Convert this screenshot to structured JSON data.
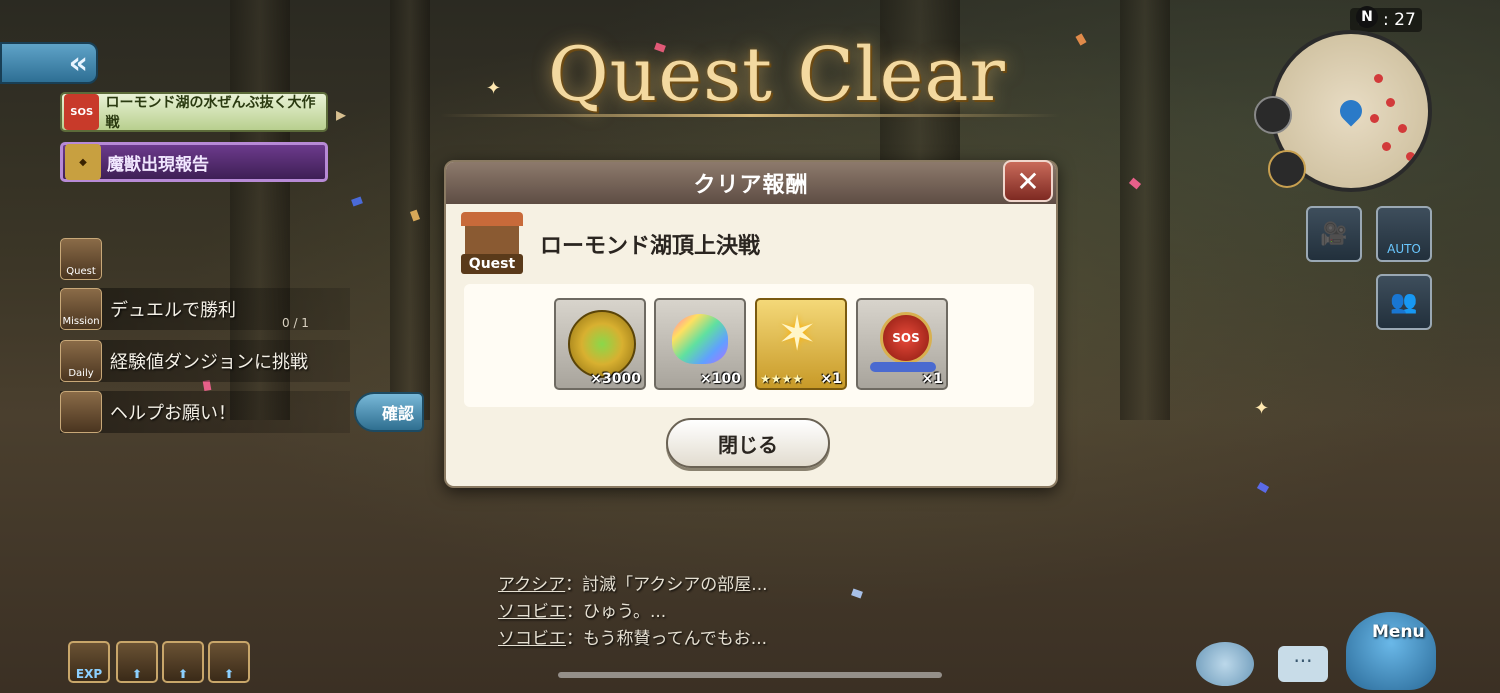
{
  "title": "Quest Clear",
  "hud": {
    "time": "07 : 27",
    "compass": "N"
  },
  "left_panel": {
    "back_label": "«",
    "event_banner": "ローモンド湖の水ぜんぶ抜く大作戦",
    "event_icon": "SOS",
    "beast_banner": "魔獣出現報告",
    "quest_icon_label": "Quest",
    "mission": {
      "tag": "Mission",
      "label": "デュエルで勝利",
      "progress": "0 / 1"
    },
    "daily": {
      "tag": "Daily",
      "label": "経験値ダンジョンに挑戦"
    },
    "help": {
      "label": "ヘルプお願い！"
    },
    "confirm_label": "確認"
  },
  "dialog": {
    "header": "クリア報酬",
    "close_icon": "✕",
    "quest_icon_label": "Quest",
    "quest_name": "ローモンド湖頂上決戦",
    "rewards": [
      {
        "icon": "gold-coin-icon",
        "qty": "×3000"
      },
      {
        "icon": "rainbow-crystal-icon",
        "qty": "×100"
      },
      {
        "icon": "star-crystal-icon",
        "qty": "×1",
        "stars": "★★★★"
      },
      {
        "icon": "sos-medal-icon",
        "qty": "×1",
        "badge": "SOS"
      }
    ],
    "close_button": "閉じる"
  },
  "right_panel": {
    "auto_label": "AUTO",
    "menu_label": "Menu"
  },
  "chat": [
    {
      "name": "アクシア",
      "message": "：討滅「アクシアの部屋..."
    },
    {
      "name": "ソコビエ",
      "message": "：ひゅう。..."
    },
    {
      "name": "ソコビエ",
      "message": "：もう称賛ってんでもお..."
    }
  ],
  "bottom_bar": {
    "exp_label": "EXP"
  },
  "colors": {
    "title_gold": "#f3d9a0",
    "header_brown": "#5e4d44",
    "close_red": "#7e2a22"
  }
}
